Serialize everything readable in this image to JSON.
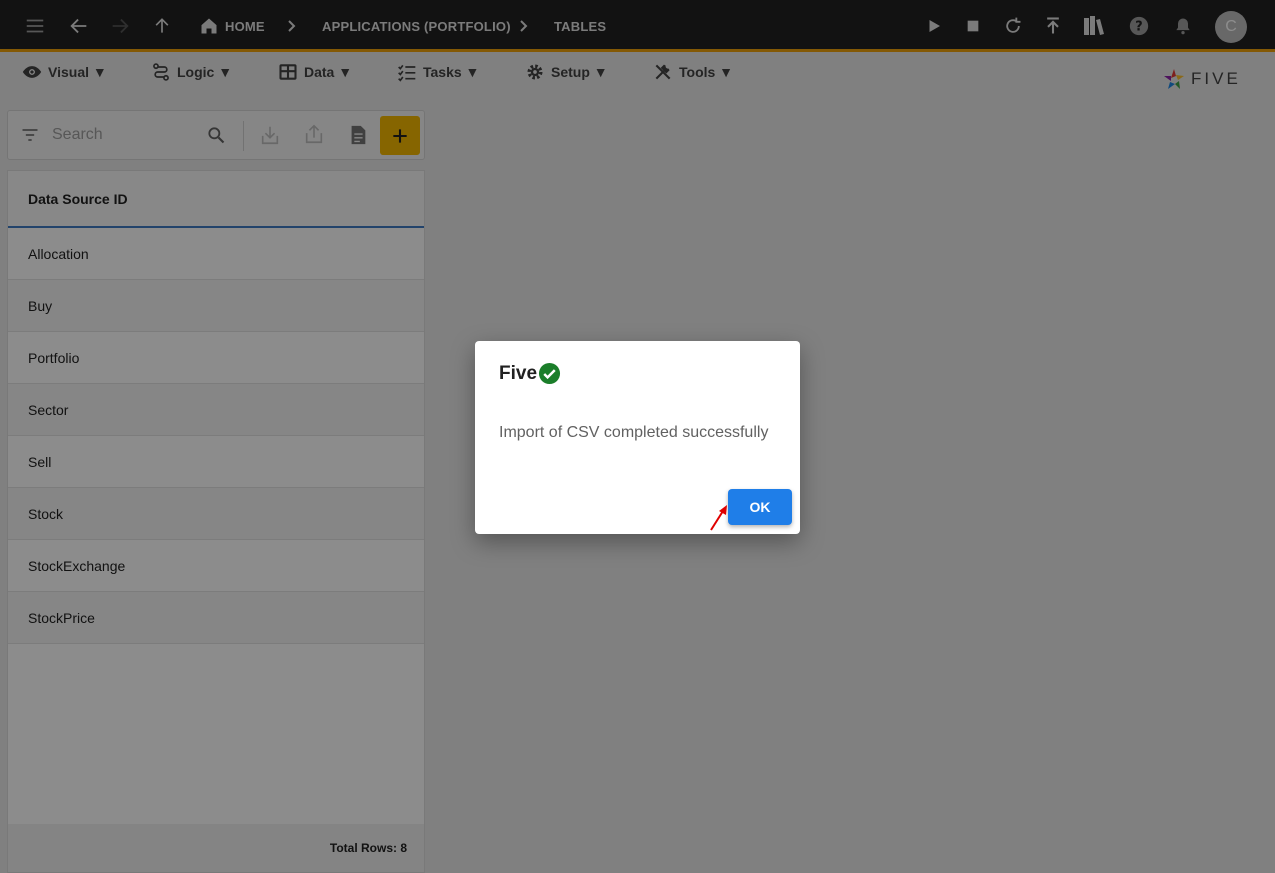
{
  "topbar": {
    "breadcrumbs": [
      "HOME",
      "APPLICATIONS (PORTFOLIO)",
      "TABLES"
    ],
    "avatar_initial": "C",
    "accent_color": "#f0a30a"
  },
  "menubar": {
    "items": [
      {
        "label": "Visual",
        "icon": "eye-icon"
      },
      {
        "label": "Logic",
        "icon": "logic-icon"
      },
      {
        "label": "Data",
        "icon": "table-icon"
      },
      {
        "label": "Tasks",
        "icon": "checklist-icon"
      },
      {
        "label": "Setup",
        "icon": "gear-icon"
      },
      {
        "label": "Tools",
        "icon": "tools-icon"
      }
    ],
    "logo_text": "FIVE"
  },
  "toolbar": {
    "search_placeholder": "Search"
  },
  "list": {
    "header": "Data Source ID",
    "rows": [
      "Allocation",
      "Buy",
      "Portfolio",
      "Sector",
      "Sell",
      "Stock",
      "StockExchange",
      "StockPrice"
    ],
    "footer": "Total Rows: 8"
  },
  "dialog": {
    "title": "Five",
    "message": "Import of CSV completed successfully",
    "ok_label": "OK",
    "ok_color": "#1f7ee8",
    "success_color": "#1b7e2a"
  }
}
